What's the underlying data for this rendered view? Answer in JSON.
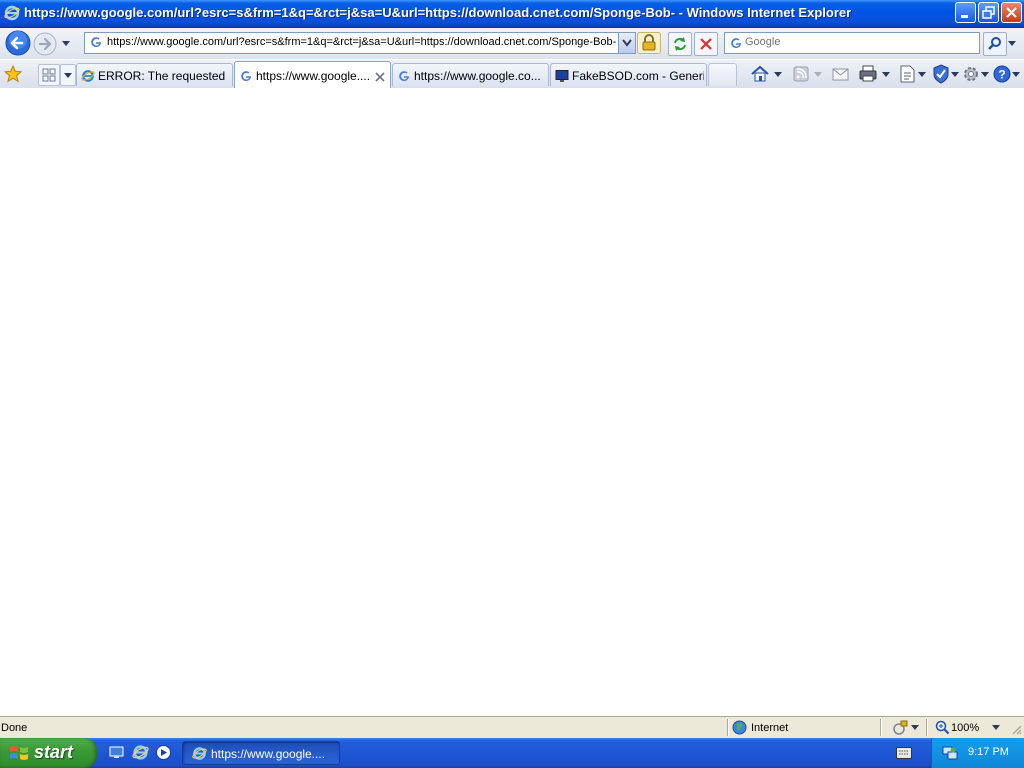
{
  "window": {
    "title": "https://www.google.com/url?esrc=s&frm=1&q=&rct=j&sa=U&url=https://download.cnet.com/Sponge-Bob- - Windows Internet Explorer"
  },
  "address_bar": {
    "url": "https://www.google.com/url?esrc=s&frm=1&q=&rct=j&sa=U&url=https://download.cnet.com/Sponge-Bob-"
  },
  "search": {
    "placeholder": "Google"
  },
  "tabs": [
    {
      "label": "ERROR: The requested ...",
      "icon": "ie-icon",
      "active": false
    },
    {
      "label": "https://www.google....",
      "icon": "google-icon",
      "active": true
    },
    {
      "label": "https://www.google.co...",
      "icon": "google-icon",
      "active": false
    },
    {
      "label": "FakeBSOD.com - Generic...",
      "icon": "monitor-icon",
      "active": false
    }
  ],
  "status_bar": {
    "status": "Done",
    "zone": "Internet",
    "zoom": "100%"
  },
  "taskbar": {
    "start_label": "start",
    "task_label": "https://www.google....",
    "clock": "9:17 PM"
  },
  "colors": {
    "titlebar_blue": "#0054e3",
    "start_green": "#3c9a37",
    "tray_blue": "#1394e4"
  }
}
